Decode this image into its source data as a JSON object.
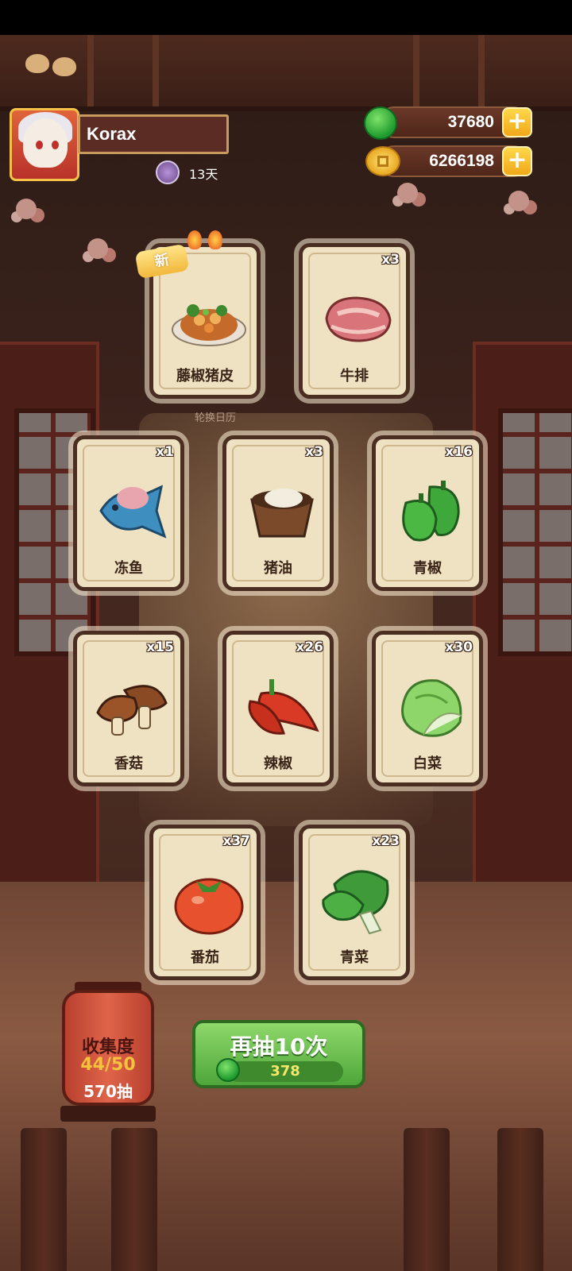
{
  "player": {
    "name": "Korax",
    "days": "13天"
  },
  "currency": {
    "jade": {
      "value": "37680",
      "icon": "jade-icon"
    },
    "coins": {
      "value": "6266198",
      "icon": "coin-icon"
    }
  },
  "cards": [
    {
      "name": "藤椒猪皮",
      "count": "",
      "badge": "新",
      "icon": "dish-icon"
    },
    {
      "name": "牛排",
      "count": "x3",
      "icon": "steak-icon"
    },
    {
      "name": "冻鱼",
      "count": "x1",
      "icon": "fish-icon"
    },
    {
      "name": "猪油",
      "count": "x3",
      "icon": "lard-icon"
    },
    {
      "name": "青椒",
      "count": "x16",
      "icon": "green-pepper-icon"
    },
    {
      "name": "香菇",
      "count": "x15",
      "icon": "mushroom-icon"
    },
    {
      "name": "辣椒",
      "count": "x26",
      "icon": "chili-icon"
    },
    {
      "name": "白菜",
      "count": "x30",
      "icon": "cabbage-icon"
    },
    {
      "name": "番茄",
      "count": "x37",
      "icon": "tomato-icon"
    },
    {
      "name": "青菜",
      "count": "x23",
      "icon": "bok-choy-icon"
    }
  ],
  "rotate_label": "轮换日历",
  "collection": {
    "title": "收集度",
    "progress": "44/50",
    "draws": "570抽"
  },
  "draw_button": {
    "label": "再抽10次",
    "cost": "378"
  }
}
